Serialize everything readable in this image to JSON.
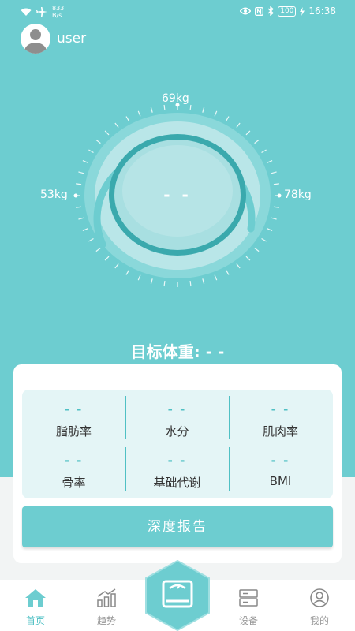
{
  "status_bar": {
    "speed_value": "833",
    "speed_unit": "B/s",
    "battery": "100",
    "time": "16:38"
  },
  "user": {
    "name": "user"
  },
  "gauge": {
    "top_label": "69kg",
    "left_label": "53kg",
    "right_label": "78kg",
    "current_weight": "- -"
  },
  "target_weight": "目标体重: - -",
  "metrics": [
    {
      "value": "- -",
      "label": "脂肪率"
    },
    {
      "value": "- -",
      "label": "水分"
    },
    {
      "value": "- -",
      "label": "肌肉率"
    },
    {
      "value": "- -",
      "label": "骨率"
    },
    {
      "value": "- -",
      "label": "基础代谢"
    },
    {
      "value": "- -",
      "label": "BMI"
    }
  ],
  "report_button": "深度报告",
  "tabs": [
    {
      "label": "首页",
      "icon": "home-icon",
      "active": true
    },
    {
      "label": "趋势",
      "icon": "trend-icon",
      "active": false
    },
    {
      "label": "设备",
      "icon": "device-icon",
      "active": false
    },
    {
      "label": "我的",
      "icon": "profile-icon",
      "active": false
    }
  ],
  "colors": {
    "primary": "#6dcdd0",
    "accent": "#4fc0c4",
    "card_bg": "#e4f5f6"
  }
}
